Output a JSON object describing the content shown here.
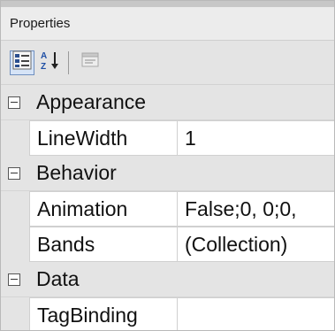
{
  "panel": {
    "title": "Properties"
  },
  "toolbar": {
    "categorized_icon": "categorized-icon",
    "alphabetical_icon": "alphabetical-icon",
    "property_pages_icon": "property-pages-icon"
  },
  "grid": {
    "categories": [
      {
        "label": "Appearance",
        "properties": [
          {
            "name": "LineWidth",
            "value": "1"
          }
        ]
      },
      {
        "label": "Behavior",
        "properties": [
          {
            "name": "Animation",
            "value": "False;0, 0;0,"
          },
          {
            "name": "Bands",
            "value": "(Collection)"
          }
        ]
      },
      {
        "label": "Data",
        "properties": [
          {
            "name": "TagBinding",
            "value": ""
          }
        ]
      }
    ]
  }
}
